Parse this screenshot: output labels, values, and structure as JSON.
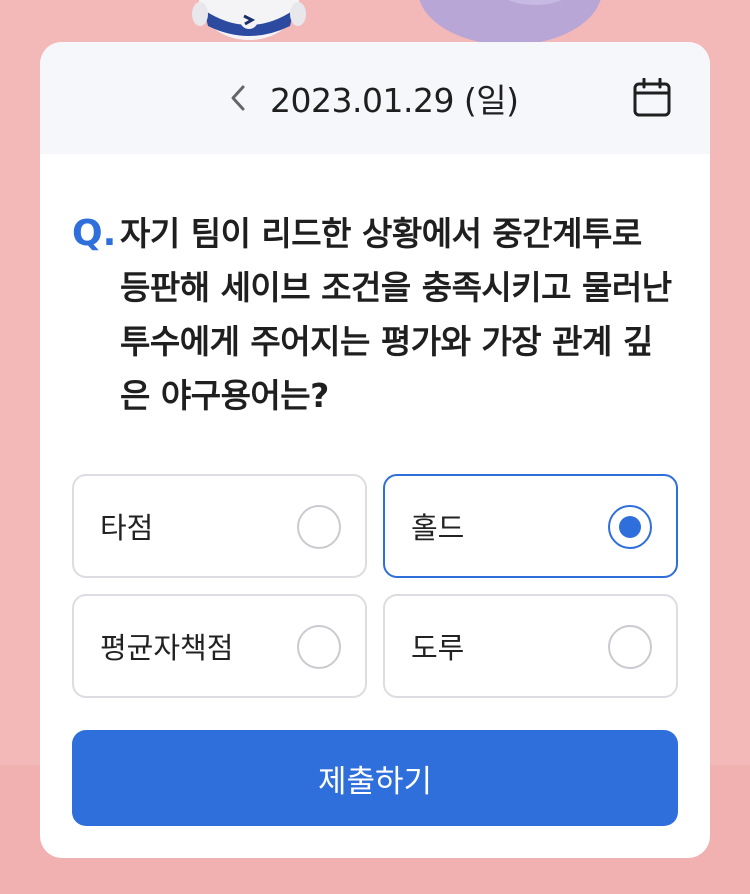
{
  "header": {
    "date": "2023.01.29 (일)",
    "prev_icon": "chevron-left-icon",
    "calendar_icon": "calendar-icon"
  },
  "question": {
    "prefix": "Q.",
    "text": "자기 팀이 리드한 상황에서 중간계투로 등판해 세이브 조건을 충족시키고 물러난 투수에게 주어지는 평가와 가장 관계 깊은 야구용어는?"
  },
  "options": [
    {
      "label": "타점",
      "selected": false
    },
    {
      "label": "홀드",
      "selected": true
    },
    {
      "label": "평균자책점",
      "selected": false
    },
    {
      "label": "도루",
      "selected": false
    }
  ],
  "submit": {
    "label": "제출하기"
  },
  "colors": {
    "accent": "#2f6fdc",
    "background": "#f3b8b8",
    "header_bg": "#f6f7fb"
  }
}
